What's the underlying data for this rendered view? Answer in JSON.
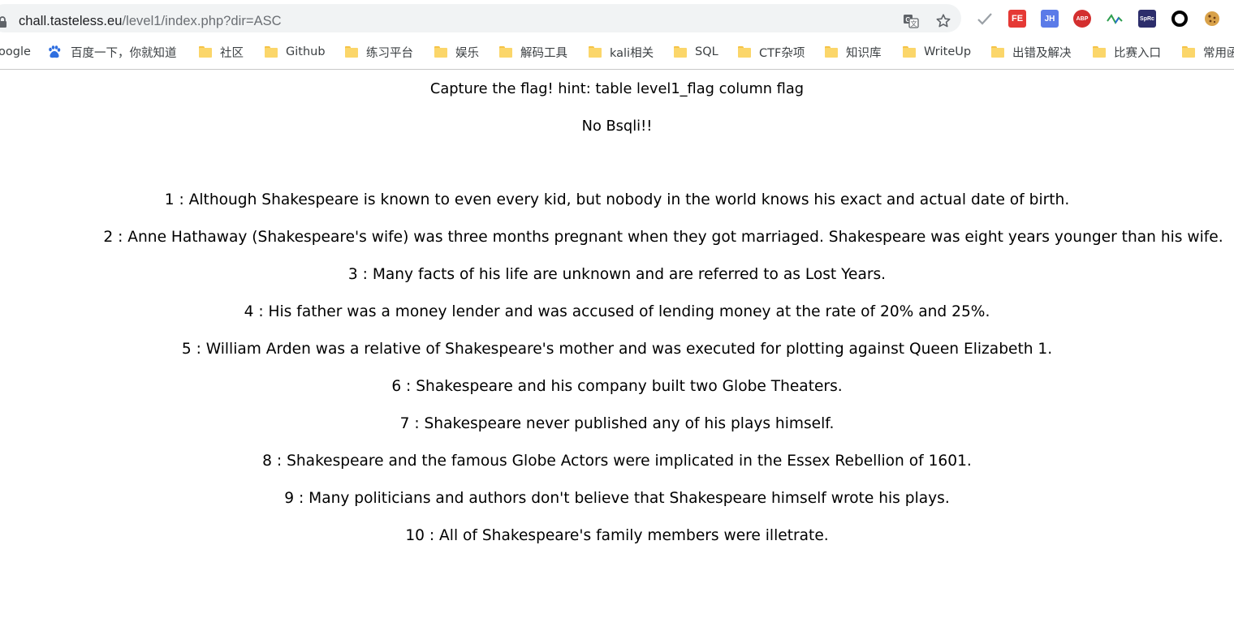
{
  "browser": {
    "url_host": "chall.tasteless.eu",
    "url_path": "/level1/index.php?dir=ASC",
    "extensions": [
      {
        "name": "fe-extension",
        "label": "FE",
        "color": "#e53935"
      },
      {
        "name": "jh-extension",
        "label": "JH",
        "color": "#5b7be8"
      },
      {
        "name": "adblock-plus",
        "label": "ABP",
        "color": "#d32f2f"
      },
      {
        "name": "sprc-extension",
        "label": "SpRc",
        "color": "#2c2d6b"
      }
    ]
  },
  "bookmarks": [
    {
      "label": "oogle",
      "icon": "google-icon"
    },
    {
      "label": "百度一下，你就知道",
      "icon": "baidu-icon"
    },
    {
      "label": "社区",
      "icon": "folder-icon"
    },
    {
      "label": "Github",
      "icon": "folder-icon"
    },
    {
      "label": "练习平台",
      "icon": "folder-icon"
    },
    {
      "label": "娱乐",
      "icon": "folder-icon"
    },
    {
      "label": "解码工具",
      "icon": "folder-icon"
    },
    {
      "label": "kali相关",
      "icon": "folder-icon"
    },
    {
      "label": "SQL",
      "icon": "folder-icon"
    },
    {
      "label": "CTF杂项",
      "icon": "folder-icon"
    },
    {
      "label": "知识库",
      "icon": "folder-icon"
    },
    {
      "label": "WriteUp",
      "icon": "folder-icon"
    },
    {
      "label": "出错及解决",
      "icon": "folder-icon"
    },
    {
      "label": "比赛入口",
      "icon": "folder-icon"
    },
    {
      "label": "常用函",
      "icon": "folder-icon"
    }
  ],
  "page": {
    "hint": "Capture the flag! hint: table level1_flag column flag",
    "notice": "No Bsqli!!",
    "facts": [
      "1 : Although Shakespeare is known to even every kid, but nobody in the world knows his exact and actual date of birth.",
      "2 : Anne Hathaway (Shakespeare's wife) was three months pregnant when they got marriaged. Shakespeare was eight years younger than his wife.",
      "3 : Many facts of his life are unknown and are referred to as Lost Years.",
      "4 : His father was a money lender and was accused of lending money at the rate of 20% and 25%.",
      "5 : William Arden was a relative of Shakespeare's mother and was executed for plotting against Queen Elizabeth 1.",
      "6 : Shakespeare and his company built two Globe Theaters.",
      "7 : Shakespeare never published any of his plays himself.",
      "8 : Shakespeare and the famous Globe Actors were implicated in the Essex Rebellion of 1601.",
      "9 : Many politicians and authors don't believe that Shakespeare himself wrote his plays.",
      "10 : All of Shakespeare's family members were illetrate."
    ]
  }
}
